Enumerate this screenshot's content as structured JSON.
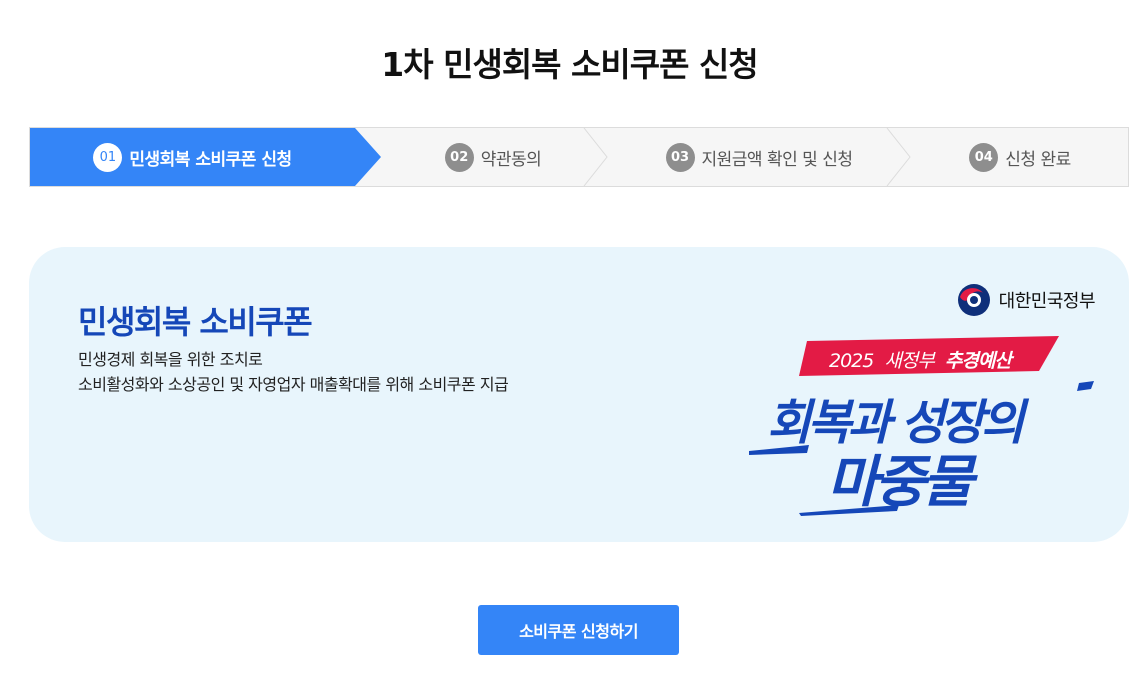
{
  "page": {
    "title": "1차 민생회복 소비쿠폰 신청"
  },
  "steps": [
    {
      "num": "01",
      "label": "민생회복 소비쿠폰 신청",
      "active": true
    },
    {
      "num": "02",
      "label": "약관동의",
      "active": false
    },
    {
      "num": "03",
      "label": "지원금액 확인 및 신청",
      "active": false
    },
    {
      "num": "04",
      "label": "신청 완료",
      "active": false
    }
  ],
  "banner": {
    "title": "민생회복 소비쿠폰",
    "line1": "민생경제 회복을 위한 조치로",
    "line2": "소비활성화와 소상공인 및 자영업자 매출확대를 위해 소비쿠폰 지급",
    "gov_logo_text": "대한민국정부",
    "slogan": {
      "tag_year": "2025",
      "tag_plain": "새정부",
      "tag_bold": "추경예산",
      "line1": "회복과 성장의",
      "line2": "마중물"
    },
    "colors": {
      "background": "#e8f5fc",
      "title": "#1547b8",
      "tag": "#e31b45",
      "slogan": "#1547b8"
    }
  },
  "cta": {
    "label": "소비쿠폰 신청하기"
  },
  "colors": {
    "accent": "#3485f7"
  }
}
